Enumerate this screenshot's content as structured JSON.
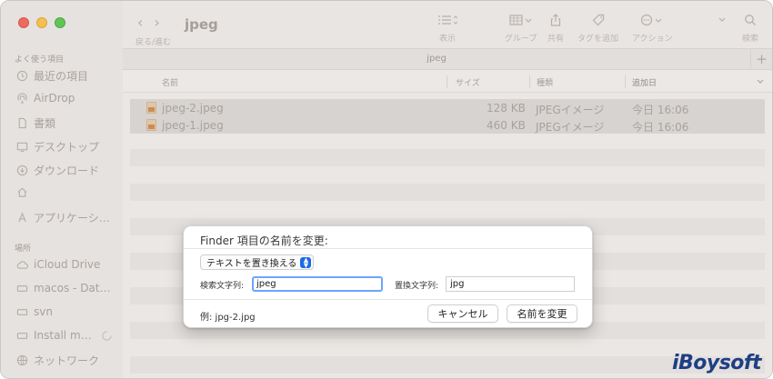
{
  "sidebar": {
    "section_favorites": "よく使う項目",
    "favorites": [
      {
        "label": "最近の項目",
        "icon": "clock-icon"
      },
      {
        "label": "AirDrop",
        "icon": "airdrop-icon"
      },
      {
        "label": "書類",
        "icon": "document-icon"
      },
      {
        "label": "デスクトップ",
        "icon": "desktop-icon"
      },
      {
        "label": "ダウンロード",
        "icon": "download-icon"
      },
      {
        "label": "",
        "icon": "home-icon"
      },
      {
        "label": "アプリケーシ…",
        "icon": "applications-icon"
      }
    ],
    "section_locations": "場所",
    "locations": [
      {
        "label": "iCloud Drive",
        "icon": "cloud-icon"
      },
      {
        "label": "macos - Dat…",
        "icon": "disk-icon"
      },
      {
        "label": "svn",
        "icon": "disk-icon"
      },
      {
        "label": "Install m…",
        "icon": "disk-icon"
      },
      {
        "label": "ネットワーク",
        "icon": "network-icon"
      }
    ]
  },
  "toolbar": {
    "nav_label": "戻る/進む",
    "title": "jpeg",
    "view_label": "表示",
    "group_label": "グループ",
    "share_label": "共有",
    "tag_label": "タグを追加",
    "action_label": "アクション",
    "search_label": "検索"
  },
  "tab": {
    "title": "jpeg"
  },
  "columns": {
    "name": "名前",
    "size": "サイズ",
    "kind": "種類",
    "date_added": "追加日"
  },
  "files": [
    {
      "name": "jpeg-2.jpeg",
      "size": "128 KB",
      "kind": "JPEGイメージ",
      "date": "今日 16:06"
    },
    {
      "name": "jpeg-1.jpeg",
      "size": "460 KB",
      "kind": "JPEGイメージ",
      "date": "今日 16:06"
    }
  ],
  "dialog": {
    "title": "Finder 項目の名前を変更:",
    "mode": "テキストを置き換える",
    "find_label": "検索文字列:",
    "find_value": "jpeg",
    "replace_label": "置換文字列:",
    "replace_value": "jpg",
    "example": "例: jpg-2.jpg",
    "cancel_label": "キャンセル",
    "rename_label": "名前を変更"
  },
  "watermark": "iBoysoft",
  "colors": {
    "accent": "#1a6be6",
    "focus_ring": "#6aa6ff",
    "watermark": "#1e3f84"
  }
}
